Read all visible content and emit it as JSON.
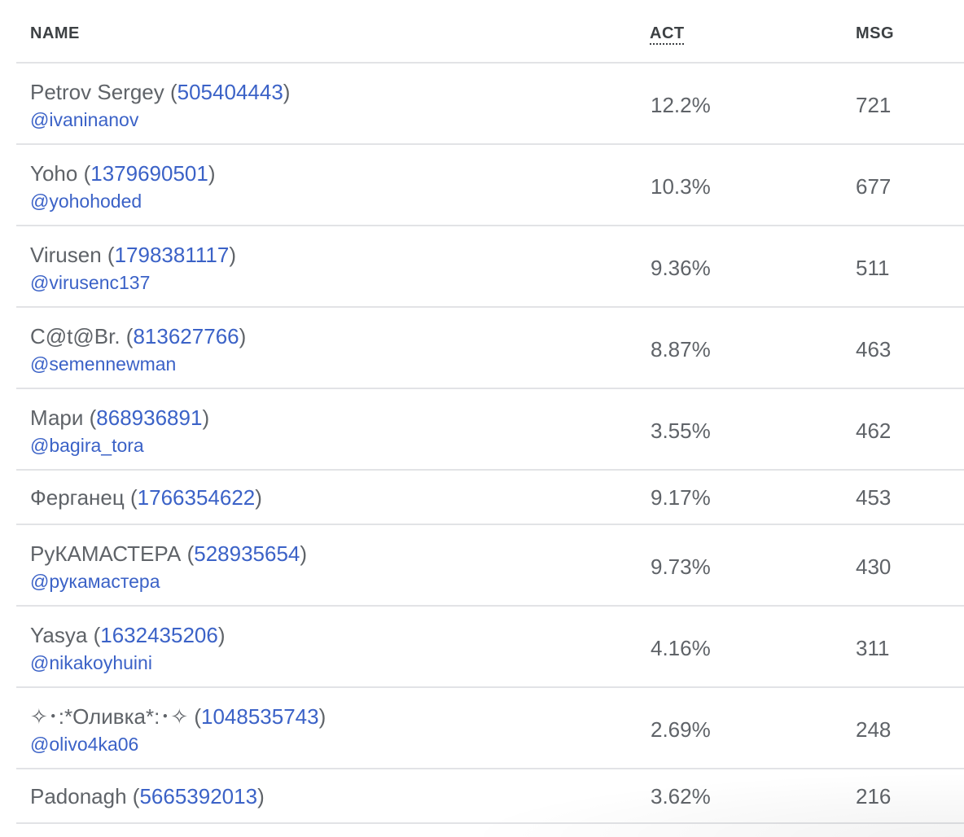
{
  "columns": {
    "name": "NAME",
    "act": "ACT",
    "msg": "MSG"
  },
  "rows": [
    {
      "name": "Petrov Sergey",
      "id": "505404443",
      "username": "@ivaninanov",
      "act": "12.2%",
      "msg": "721"
    },
    {
      "name": "Yoho",
      "id": "1379690501",
      "username": "@yohohoded",
      "act": "10.3%",
      "msg": "677"
    },
    {
      "name": "Virusen",
      "id": "1798381117",
      "username": "@virusenc137",
      "act": "9.36%",
      "msg": "511"
    },
    {
      "name": "C@t@Br.",
      "id": "813627766",
      "username": "@semennewman",
      "act": "8.87%",
      "msg": "463"
    },
    {
      "name": "Мари",
      "id": "868936891",
      "username": "@bagira_tora",
      "act": "3.55%",
      "msg": "462"
    },
    {
      "name": "Ферганец",
      "id": "1766354622",
      "username": "",
      "act": "9.17%",
      "msg": "453"
    },
    {
      "name": "РуКАМАСТЕРА",
      "id": "528935654",
      "username": "@рукамастера",
      "act": "9.73%",
      "msg": "430"
    },
    {
      "name": "Yasya",
      "id": "1632435206",
      "username": "@nikakoyhuini",
      "act": "4.16%",
      "msg": "311"
    },
    {
      "name": "✧･:*Оливка*:･✧",
      "id": "1048535743",
      "username": "@olivo4ka06",
      "act": "2.69%",
      "msg": "248"
    },
    {
      "name": "Padonagh",
      "id": "5665392013",
      "username": "",
      "act": "3.62%",
      "msg": "216"
    }
  ]
}
